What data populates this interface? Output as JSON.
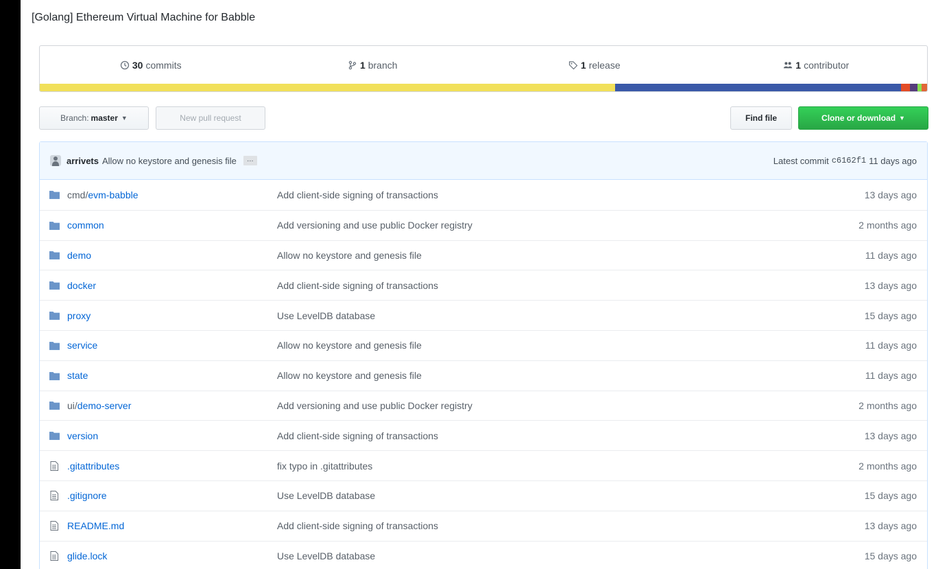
{
  "repo": {
    "description": "[Golang] Ethereum Virtual Machine for Babble"
  },
  "summary": {
    "commits_count": "30",
    "commits_label": "commits",
    "branch_count": "1",
    "branch_label": "branch",
    "release_count": "1",
    "release_label": "release",
    "contributor_count": "1",
    "contributor_label": "contributor"
  },
  "language_bar": [
    {
      "color": "#f1e05a",
      "percent": 64.8
    },
    {
      "color": "#3a59a8",
      "percent": 32.3
    },
    {
      "color": "#e34c26",
      "percent": 1.0
    },
    {
      "color": "#563d7c",
      "percent": 0.8
    },
    {
      "color": "#89e051",
      "percent": 0.5
    },
    {
      "color": "#e16737",
      "percent": 0.6
    }
  ],
  "toolbar": {
    "branch_prefix": "Branch:",
    "branch_name": "master",
    "new_pr_label": "New pull request",
    "find_file_label": "Find file",
    "clone_label": "Clone or download"
  },
  "latest_commit": {
    "author": "arrivets",
    "message": "Allow no keystore and genesis file",
    "ellipsis": "…",
    "prefix": "Latest commit",
    "sha": "c6162f1",
    "age": "11 days ago"
  },
  "files": [
    {
      "type": "dir",
      "dim": "cmd/",
      "name": "evm-babble",
      "message": "Add client-side signing of transactions",
      "age": "13 days ago"
    },
    {
      "type": "dir",
      "dim": "",
      "name": "common",
      "message": "Add versioning and use public Docker registry",
      "age": "2 months ago"
    },
    {
      "type": "dir",
      "dim": "",
      "name": "demo",
      "message": "Allow no keystore and genesis file",
      "age": "11 days ago"
    },
    {
      "type": "dir",
      "dim": "",
      "name": "docker",
      "message": "Add client-side signing of transactions",
      "age": "13 days ago"
    },
    {
      "type": "dir",
      "dim": "",
      "name": "proxy",
      "message": "Use LevelDB database",
      "age": "15 days ago"
    },
    {
      "type": "dir",
      "dim": "",
      "name": "service",
      "message": "Allow no keystore and genesis file",
      "age": "11 days ago"
    },
    {
      "type": "dir",
      "dim": "",
      "name": "state",
      "message": "Allow no keystore and genesis file",
      "age": "11 days ago"
    },
    {
      "type": "dir",
      "dim": "ui/",
      "name": "demo-server",
      "message": "Add versioning and use public Docker registry",
      "age": "2 months ago"
    },
    {
      "type": "dir",
      "dim": "",
      "name": "version",
      "message": "Add client-side signing of transactions",
      "age": "13 days ago"
    },
    {
      "type": "file",
      "dim": "",
      "name": ".gitattributes",
      "message": "fix typo in .gitattributes",
      "age": "2 months ago"
    },
    {
      "type": "file",
      "dim": "",
      "name": ".gitignore",
      "message": "Use LevelDB database",
      "age": "15 days ago"
    },
    {
      "type": "file",
      "dim": "",
      "name": "README.md",
      "message": "Add client-side signing of transactions",
      "age": "13 days ago"
    },
    {
      "type": "file",
      "dim": "",
      "name": "glide.lock",
      "message": "Use LevelDB database",
      "age": "15 days ago"
    }
  ]
}
